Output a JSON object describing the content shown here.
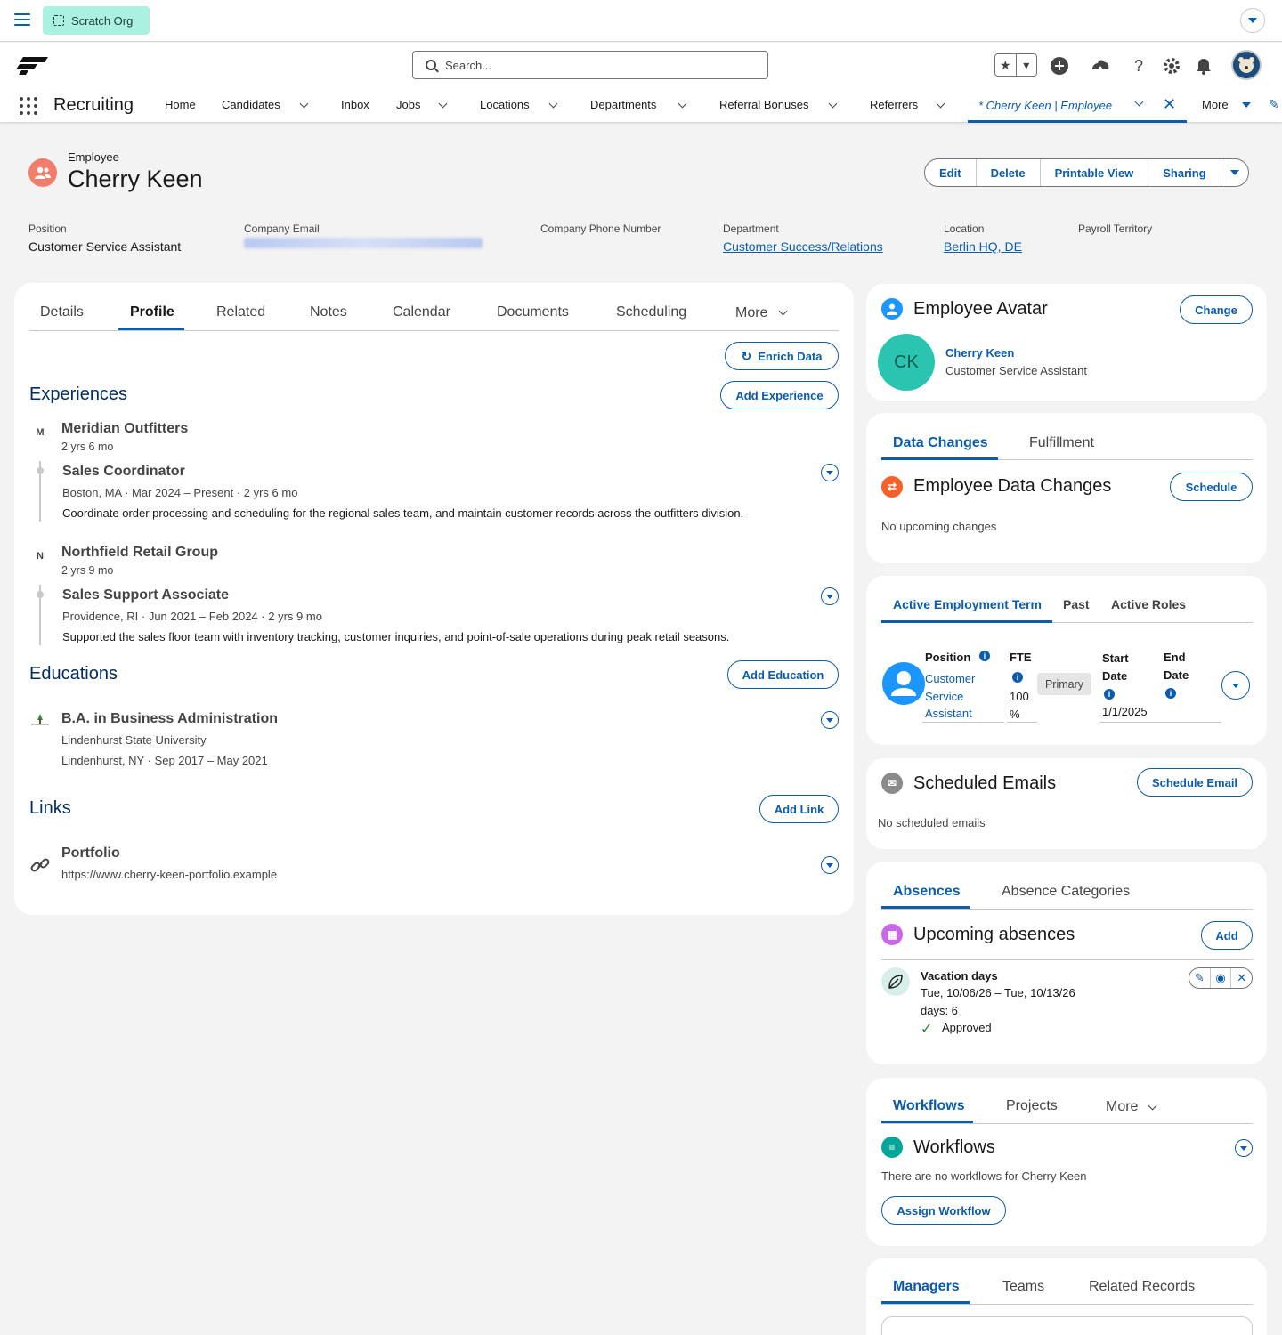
{
  "utility": {
    "org_label": "Scratch Org"
  },
  "header": {
    "search_placeholder": "Search..."
  },
  "nav": {
    "app_name": "Recruiting",
    "items": [
      "Home",
      "Candidates",
      "Inbox",
      "Jobs",
      "Locations",
      "Departments",
      "Referral Bonuses",
      "Referrers"
    ],
    "active_tab": "* Cherry Keen | Employee",
    "more": "More"
  },
  "record": {
    "type": "Employee",
    "name": "Cherry Keen",
    "actions": [
      "Edit",
      "Delete",
      "Printable View",
      "Sharing"
    ],
    "fields": [
      {
        "label": "Position",
        "value": "Customer Service Assistant"
      },
      {
        "label": "Company Email",
        "value": ""
      },
      {
        "label": "Company Phone Number",
        "value": ""
      },
      {
        "label": "Department",
        "value": "Customer Success/Relations"
      },
      {
        "label": "Location",
        "value": "Berlin HQ, DE"
      },
      {
        "label": "Payroll Territory",
        "value": ""
      }
    ]
  },
  "main_tabs": [
    "Details",
    "Profile",
    "Related",
    "Notes",
    "Calendar",
    "Documents",
    "Scheduling",
    "More"
  ],
  "profile": {
    "enrich": "Enrich Data",
    "experiences_title": "Experiences",
    "add_experience": "Add Experience",
    "experiences": [
      {
        "initial": "M",
        "company": "Meridian Outfitters",
        "duration": "2 yrs 6 mo",
        "role": "Sales Coordinator",
        "meta": "Boston, MA · Mar 2024 – Present · 2 yrs 6 mo",
        "desc": "Coordinate order processing and scheduling for the regional sales team, and maintain customer records across the outfitters division."
      },
      {
        "initial": "N",
        "company": "Northfield Retail Group",
        "duration": "2 yrs 9 mo",
        "role": "Sales Support Associate",
        "meta": "Providence, RI · Jun 2021 – Feb 2024 · 2 yrs 9 mo",
        "desc": "Supported the sales floor team with inventory tracking, customer inquiries, and point-of-sale operations during peak retail seasons."
      }
    ],
    "educations_title": "Educations",
    "add_education": "Add Education",
    "education": {
      "degree": "B.A. in Business Administration",
      "school": "Lindenhurst State University",
      "meta": "Lindenhurst, NY · Sep 2017 – May 2021"
    },
    "links_title": "Links",
    "add_link": "Add Link",
    "link": {
      "label": "Portfolio",
      "url": "https://www.cherry-keen-portfolio.example"
    }
  },
  "avatar_card": {
    "title": "Employee Avatar",
    "change": "Change",
    "initials": "CK",
    "name": "Cherry Keen",
    "position": "Customer Service Assistant"
  },
  "data_changes": {
    "tabs": [
      "Data Changes",
      "Fulfillment"
    ],
    "title": "Employee Data Changes",
    "schedule": "Schedule",
    "empty": "No upcoming changes"
  },
  "employment": {
    "tabs": [
      "Active Employment Term",
      "Past",
      "Active Roles"
    ],
    "position_label": "Position",
    "position_value": [
      "Customer",
      "Service",
      "Assistant"
    ],
    "fte_label": "FTE",
    "fte_value": [
      "100",
      "%"
    ],
    "primary": "Primary",
    "start_label": [
      "Start",
      "Date"
    ],
    "start_value": "1/1/2025",
    "end_label": [
      "End",
      "Date"
    ]
  },
  "emails": {
    "title": "Scheduled Emails",
    "button": "Schedule Email",
    "empty": "No scheduled emails"
  },
  "absences": {
    "tabs": [
      "Absences",
      "Absence Categories"
    ],
    "title": "Upcoming absences",
    "add": "Add",
    "item": {
      "type": "Vacation days",
      "dates": "Tue, 10/06/26 – Tue, 10/13/26",
      "days": "days: 6",
      "status": "Approved"
    }
  },
  "workflows": {
    "tabs": [
      "Workflows",
      "Projects",
      "More"
    ],
    "title": "Workflows",
    "empty": "There are no workflows for Cherry Keen",
    "button": "Assign Workflow"
  },
  "managers": {
    "tabs": [
      "Managers",
      "Teams",
      "Related Records"
    ]
  },
  "colors": {
    "brand_blue": "#0b5cab",
    "scratch_bg": "#aaf1e2",
    "avatar_bg": "#2bc4b0"
  }
}
